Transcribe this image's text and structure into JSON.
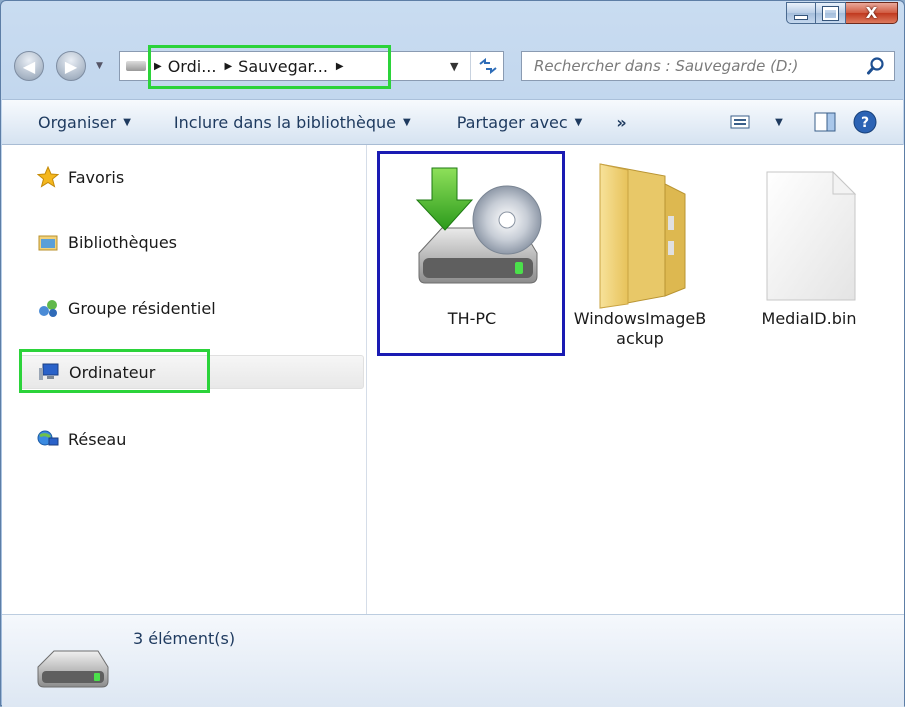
{
  "window": {
    "caption": {
      "minimize": "minimize",
      "maximize": "maximize",
      "close": "X"
    }
  },
  "address": {
    "crumbs": [
      "Ordi...",
      "Sauvegar..."
    ],
    "trailing_arrow": "▸"
  },
  "search": {
    "placeholder": "Rechercher dans : Sauvegarde (D:)"
  },
  "toolbar": {
    "organiser": "Organiser",
    "include": "Inclure dans la bibliothèque",
    "share": "Partager avec",
    "more": "»"
  },
  "navpane": {
    "items": [
      {
        "label": "Favoris",
        "icon": "star-icon"
      },
      {
        "label": "Bibliothèques",
        "icon": "library-icon"
      },
      {
        "label": "Groupe résidentiel",
        "icon": "homegroup-icon"
      },
      {
        "label": "Ordinateur",
        "icon": "computer-icon",
        "selected": true
      },
      {
        "label": "Réseau",
        "icon": "network-icon"
      }
    ]
  },
  "files": [
    {
      "label": "TH-PC",
      "icon": "backup-drive-icon"
    },
    {
      "label": "WindowsImageBackup",
      "label_lines": [
        "WindowsImageB",
        "ackup"
      ],
      "icon": "folder-icon"
    },
    {
      "label": "MediaID.bin",
      "icon": "file-icon"
    }
  ],
  "details": {
    "count": "3 élément(s)"
  },
  "colors": {
    "highlight_green": "#2bd33a",
    "highlight_blue": "#1a1bb3"
  }
}
